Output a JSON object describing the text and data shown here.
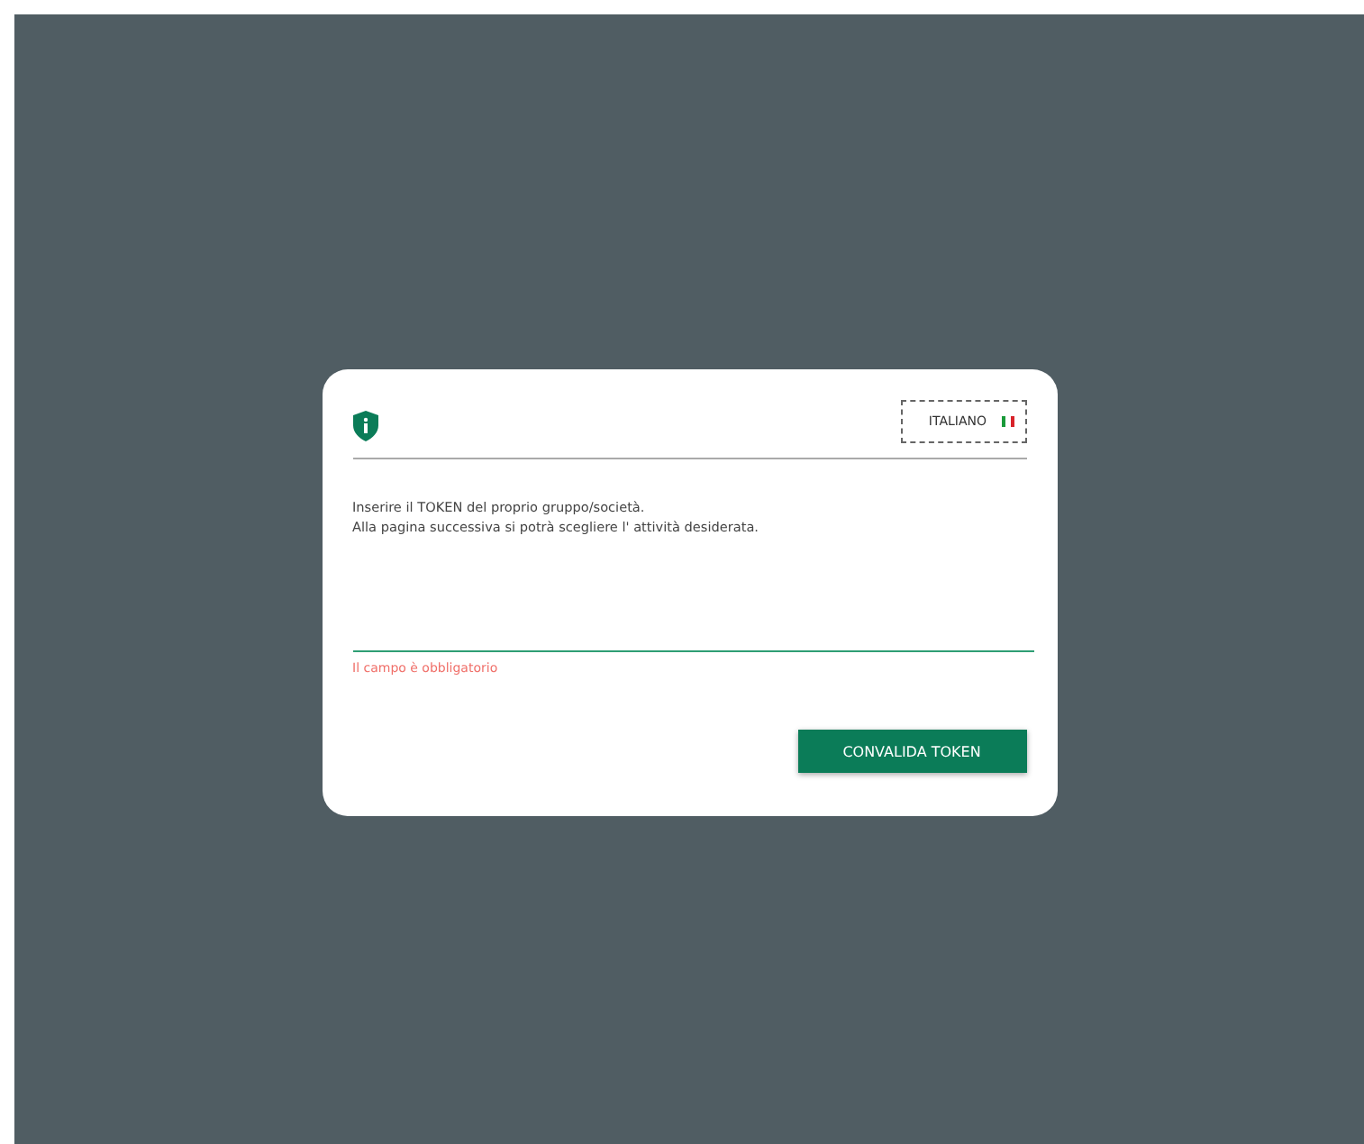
{
  "language": {
    "label": "ITALIANO"
  },
  "instructions": [
    "Inserire il TOKEN del proprio gruppo/società.",
    "Alla pagina successiva si potrà scegliere l' attività desiderata."
  ],
  "token_field": {
    "error": "Il campo è obbligatorio"
  },
  "submit_button": {
    "label": "CONVALIDA TOKEN"
  }
}
